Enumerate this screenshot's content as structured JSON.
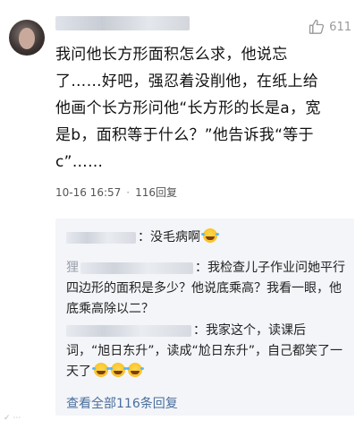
{
  "comment": {
    "like_count": "611",
    "text": "我问他长方形面积怎么求，他说忘\n了……好吧，强忍着没削他，在纸上给\n他画个长方形问他“长方形的长是a，宽\n是b，面积等于什么？”他告诉我“等于\nc”……",
    "timestamp": "10-16 16:57",
    "separator": "·",
    "reply_count_label": "116回复"
  },
  "replies": [
    {
      "name_glyph": "",
      "text": "：没毛病啊"
    },
    {
      "name_glyph": "狸",
      "text": "：我检查儿子作业问她平行四边形的面积是多少？他说底乘高？我看一眼，他底乘高除以二？"
    },
    {
      "name_glyph": "",
      "text": "：我家这个，读课后词，“旭日东升”，读成“尬日东升”，自己都笑了一天了"
    }
  ],
  "view_all_label": "查看全部116条回复",
  "icons": {
    "like": "thumbs-up-icon",
    "emoji": "laughing-tears-emoji-icon"
  },
  "colors": {
    "link": "#4a6e9c",
    "reply_background": "#f3f5f9",
    "muted": "#9a9a9a"
  }
}
